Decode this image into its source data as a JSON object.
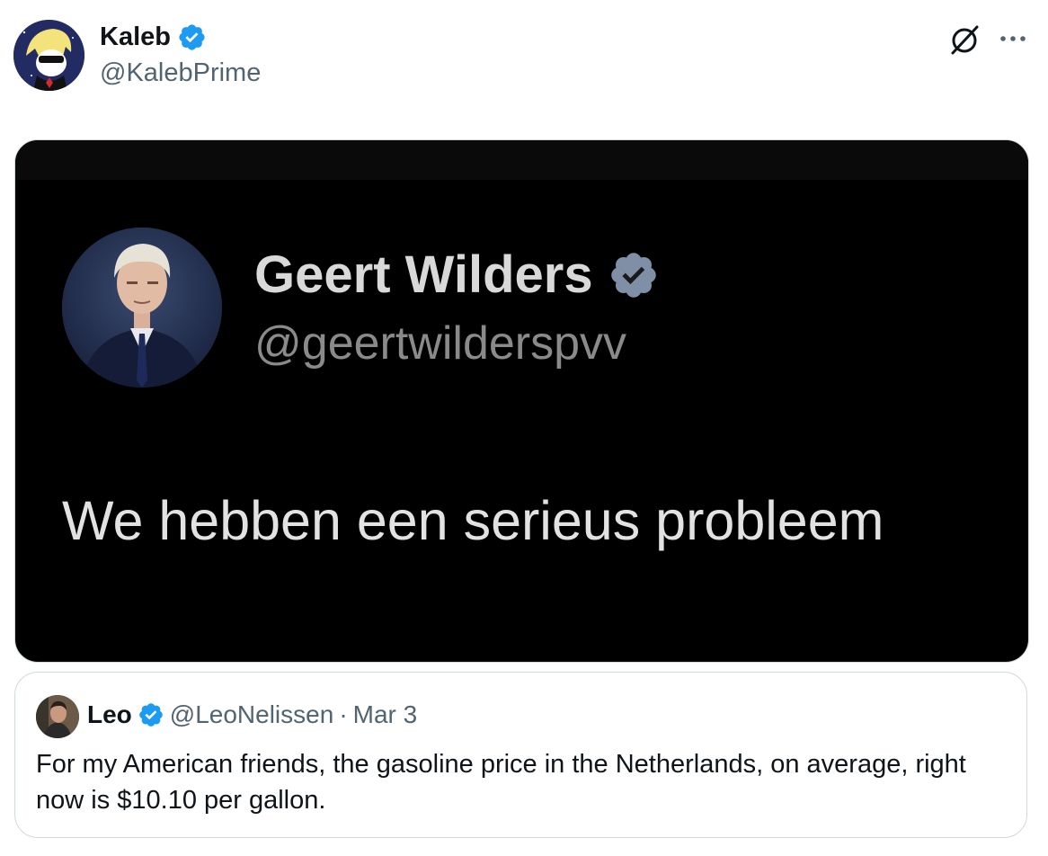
{
  "tweet": {
    "author_name": "Kaleb",
    "author_handle": "@KalebPrime",
    "verified": true
  },
  "media": {
    "embedded_name": "Geert Wilders",
    "embedded_handle": "@geertwilderspvv",
    "embedded_text": "We hebben een serieus probleem"
  },
  "quote": {
    "name": "Leo",
    "handle": "@LeoNelissen",
    "separator": "·",
    "date": "Mar 3",
    "text": "For my American friends, the gasoline price in the Netherlands, on average, right now is $10.10 per gallon."
  },
  "colors": {
    "verified_blue": "#1d9bf0",
    "secondary_text": "#536471",
    "border": "#cfd9de"
  },
  "icons": {
    "grok": "grok-icon",
    "more": "more-icon",
    "verified": "verified-badge-icon"
  }
}
